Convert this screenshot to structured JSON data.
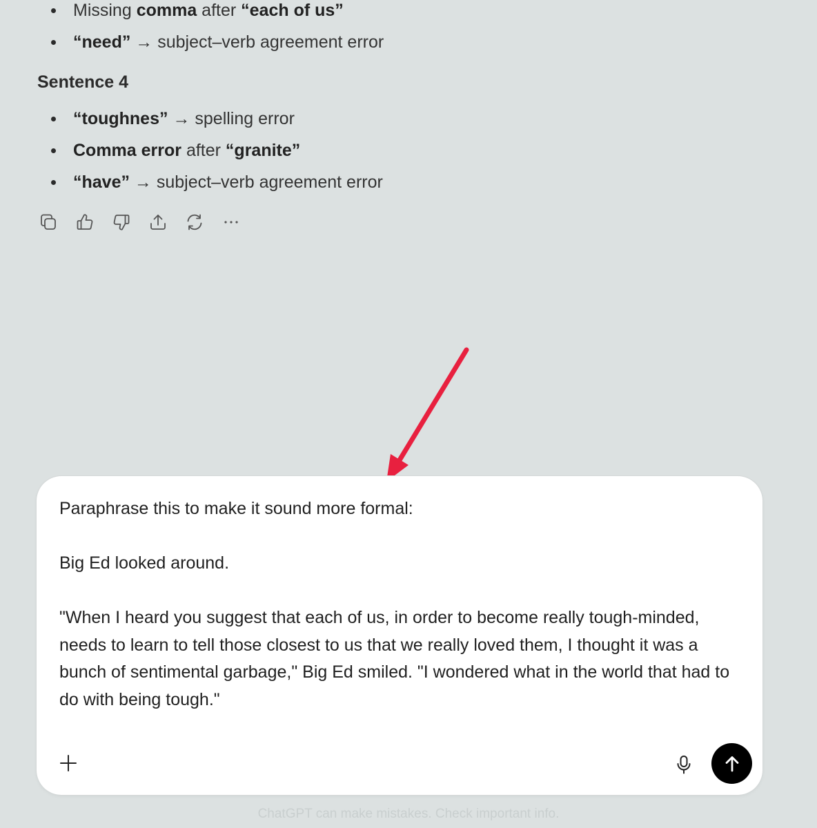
{
  "response": {
    "top_items": [
      {
        "parts": [
          {
            "t": "Missing ",
            "b": false
          },
          {
            "t": "comma",
            "b": true
          },
          {
            "t": " after ",
            "b": false
          },
          {
            "t": "“each of us”",
            "b": true
          }
        ]
      },
      {
        "parts": [
          {
            "t": "“need”",
            "b": true
          },
          {
            "t": " → subject–verb agreement error",
            "b": false
          }
        ]
      }
    ],
    "section_heading": "Sentence 4",
    "bottom_items": [
      {
        "parts": [
          {
            "t": "“toughnes”",
            "b": true
          },
          {
            "t": " → spelling error",
            "b": false
          }
        ]
      },
      {
        "parts": [
          {
            "t": "Comma error",
            "b": true
          },
          {
            "t": " after ",
            "b": false
          },
          {
            "t": "“granite”",
            "b": true
          }
        ]
      },
      {
        "parts": [
          {
            "t": "“have”",
            "b": true
          },
          {
            "t": " → subject–verb agreement error",
            "b": false
          }
        ]
      }
    ],
    "action_icons": [
      "copy-icon",
      "thumbs-up-icon",
      "thumbs-down-icon",
      "share-icon",
      "regenerate-icon",
      "more-icon"
    ]
  },
  "composer": {
    "paragraphs": [
      "Paraphrase this to make it sound more formal:",
      "Big Ed looked around.",
      "\"When I heard you suggest that each of us, in order to become really tough-minded, needs to learn to tell those closest to us that we really loved them, I thought it was a bunch of sentimental garbage,\" Big Ed smiled. \"I wondered what in the world that had to do with being tough.\""
    ],
    "plus_icon": "plus-icon",
    "mic_icon": "microphone-icon",
    "send_icon": "arrow-up-icon"
  },
  "footer": {
    "note": "ChatGPT can make mistakes. Check important info."
  },
  "annotation": {
    "arrow_color": "#e8203f"
  }
}
